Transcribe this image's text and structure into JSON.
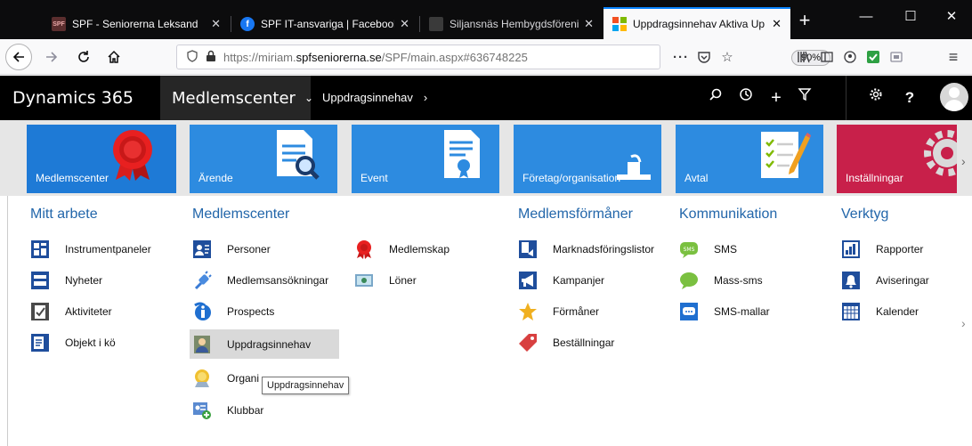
{
  "browser": {
    "tabs": [
      {
        "title": "SPF - Seniorerna Leksand",
        "favicon": "spf-logo-icon",
        "favicon_text": "SPF"
      },
      {
        "title": "SPF IT-ansvariga | Facebook",
        "favicon": "facebook-icon"
      },
      {
        "title": "Siljansnäs Hembygdsförening",
        "favicon": "site-icon"
      },
      {
        "title": "Uppdragsinnehav Aktiva Up",
        "favicon": "dynamics-icon",
        "active": true
      }
    ],
    "new_tab": "+",
    "url_prefix": "https://miriam.",
    "url_domain": "spfseniorerna.se",
    "url_path": "/SPF/main.aspx#636748225",
    "zoom": "90%",
    "page_actions": "···"
  },
  "app": {
    "brand": "Dynamics 365",
    "area": "Medlemscenter",
    "breadcrumb": "Uppdragsinnehav",
    "icons": [
      "search-icon",
      "history-icon",
      "plus-icon",
      "filter-icon",
      "gear-icon",
      "help-icon",
      "user-avatar-icon"
    ],
    "help_label": "?"
  },
  "tiles": [
    {
      "label": "Medlemscenter",
      "color": "#1e7ad6",
      "icon": "ribbon-award-icon"
    },
    {
      "label": "Ärende",
      "color": "#2d8be0",
      "icon": "document-search-icon"
    },
    {
      "label": "Event",
      "color": "#2d8be0",
      "icon": "certificate-icon"
    },
    {
      "label": "Företag/organisation",
      "color": "#2d8be0",
      "icon": "building-icon"
    },
    {
      "label": "Avtal",
      "color": "#2d8be0",
      "icon": "contract-pencil-icon"
    },
    {
      "label": "Inställningar",
      "color": "#c8204a",
      "icon": "settings-gear-icon"
    }
  ],
  "columns": {
    "mitt_arbete": {
      "title": "Mitt arbete",
      "items": [
        "Instrumentpaneler",
        "Nyheter",
        "Aktiviteter",
        "Objekt i kö"
      ]
    },
    "medlemscenter": {
      "title": "Medlemscenter",
      "items_a": [
        "Personer",
        "Medlemsansökningar",
        "Prospects",
        "Uppdragsinnehav",
        "Organi",
        "Klubbar"
      ],
      "items_b": [
        "Medlemskap",
        "Löner"
      ]
    },
    "medlemsformaner": {
      "title": "Medlemsförmåner",
      "items": [
        "Marknadsföringslistor",
        "Kampanjer",
        "Förmåner",
        "Beställningar"
      ]
    },
    "kommunikation": {
      "title": "Kommunikation",
      "items": [
        "SMS",
        "Mass-sms",
        "SMS-mallar"
      ]
    },
    "verktyg": {
      "title": "Verktyg",
      "items": [
        "Rapporter",
        "Aviseringar",
        "Kalender"
      ]
    }
  },
  "tooltip": "Uppdragsinnehav",
  "colors": {
    "accent": "#2266aa",
    "selected": "#d9d9d9",
    "topbar": "#000000"
  }
}
